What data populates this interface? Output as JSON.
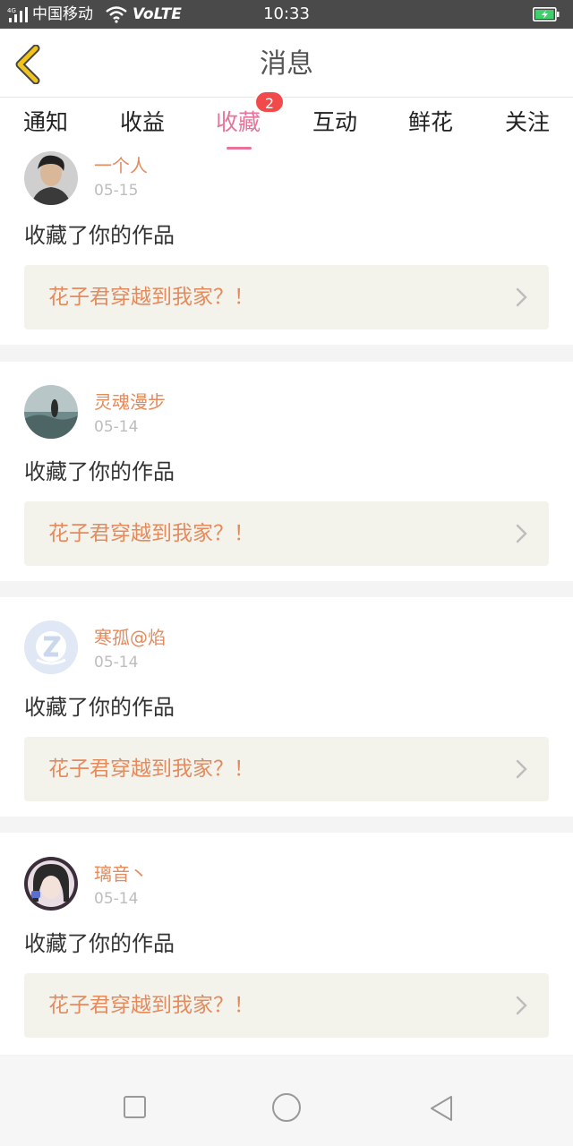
{
  "status_bar": {
    "signal_label": "4G",
    "carrier": "中国移动",
    "volte": "VoLTE",
    "time": "10:33",
    "battery_color": "#3fd06b"
  },
  "header": {
    "title": "消息",
    "back_icon": "chevron-left-icon",
    "back_color": "#f0c419"
  },
  "tabs": {
    "items": [
      "通知",
      "收益",
      "收藏",
      "互动",
      "鲜花",
      "关注"
    ],
    "active": "收藏",
    "badge": "2",
    "active_color": "#e8739a"
  },
  "notifications": [
    {
      "user": "一个人",
      "date": "05-15",
      "action": "收藏了你的作品",
      "work": "花子君穿越到我家？！"
    },
    {
      "user": "灵魂漫步",
      "date": "05-14",
      "action": "收藏了你的作品",
      "work": "花子君穿越到我家？！"
    },
    {
      "user": "寒孤@焰",
      "date": "05-14",
      "action": "收藏了你的作品",
      "work": "花子君穿越到我家？！"
    },
    {
      "user": "璃音丶",
      "date": "05-14",
      "action": "收藏了你的作品",
      "work": "花子君穿越到我家？！"
    }
  ],
  "nav_bar": {
    "icons": [
      "square-recent-apps-icon",
      "circle-home-icon",
      "triangle-back-icon"
    ]
  }
}
